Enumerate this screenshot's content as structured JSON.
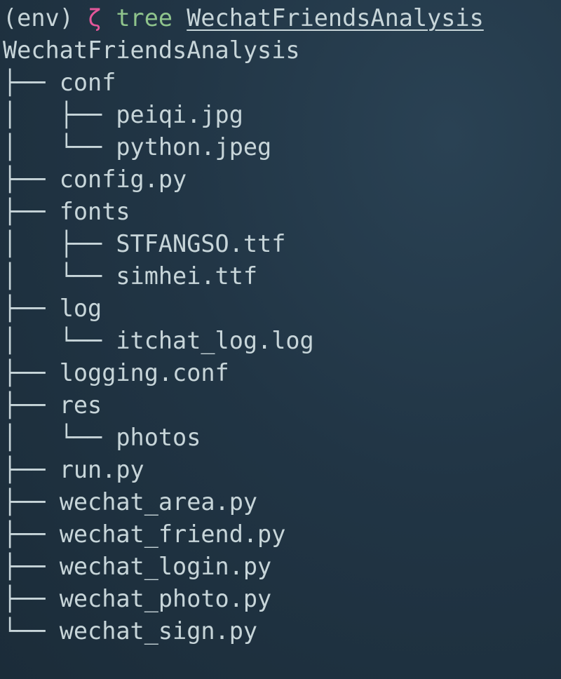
{
  "prompt": {
    "env": "(env)",
    "symbol": "ζ",
    "command": "tree",
    "argument": "WechatFriendsAnalysis"
  },
  "root": "WechatFriendsAnalysis",
  "tree_lines": [
    {
      "prefix": "├── ",
      "name": "conf"
    },
    {
      "prefix": "│   ├── ",
      "name": "peiqi.jpg"
    },
    {
      "prefix": "│   └── ",
      "name": "python.jpeg"
    },
    {
      "prefix": "├── ",
      "name": "config.py"
    },
    {
      "prefix": "├── ",
      "name": "fonts"
    },
    {
      "prefix": "│   ├── ",
      "name": "STFANGSO.ttf"
    },
    {
      "prefix": "│   └── ",
      "name": "simhei.ttf"
    },
    {
      "prefix": "├── ",
      "name": "log"
    },
    {
      "prefix": "│   └── ",
      "name": "itchat_log.log"
    },
    {
      "prefix": "├── ",
      "name": "logging.conf"
    },
    {
      "prefix": "├── ",
      "name": "res"
    },
    {
      "prefix": "│   └── ",
      "name": "photos"
    },
    {
      "prefix": "├── ",
      "name": "run.py"
    },
    {
      "prefix": "├── ",
      "name": "wechat_area.py"
    },
    {
      "prefix": "├── ",
      "name": "wechat_friend.py"
    },
    {
      "prefix": "├── ",
      "name": "wechat_login.py"
    },
    {
      "prefix": "├── ",
      "name": "wechat_photo.py"
    },
    {
      "prefix": "└── ",
      "name": "wechat_sign.py"
    }
  ]
}
